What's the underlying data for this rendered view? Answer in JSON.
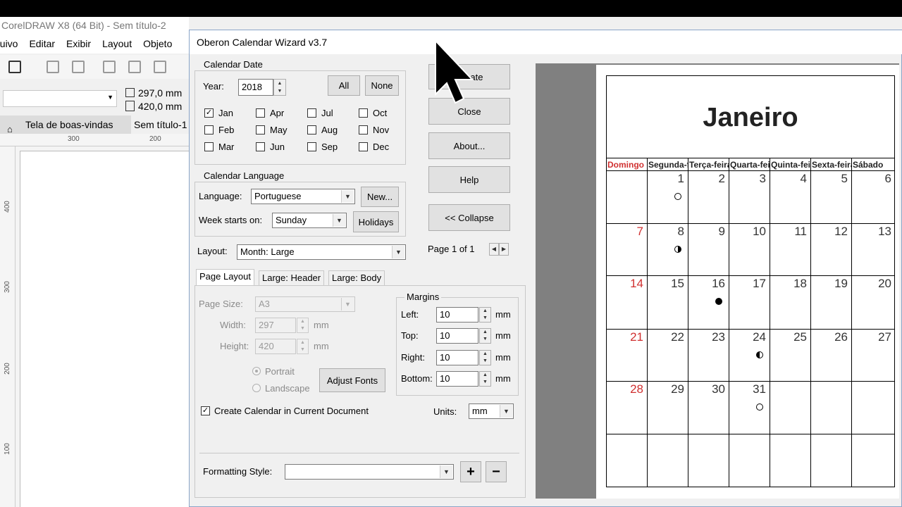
{
  "corel": {
    "title": "CorelDRAW X8 (64 Bit) - Sem título-2",
    "menu": [
      "Arquivo",
      "Editar",
      "Exibir",
      "Layout",
      "Objeto"
    ],
    "width_value": "297,0 mm",
    "height_value": "420,0 mm",
    "tabs": [
      "Tela de boas-vindas",
      "Sem título-1"
    ],
    "ruler_ticks": [
      "300",
      "200"
    ],
    "vruler_ticks": [
      "400",
      "300",
      "200",
      "100"
    ]
  },
  "dialog": {
    "title": "Oberon Calendar Wizard v3.7",
    "calendar_date": {
      "legend": "Calendar Date",
      "year_label": "Year:",
      "year_value": "2018",
      "all_label": "All",
      "none_label": "None",
      "months": [
        {
          "label": "Jan",
          "checked": true
        },
        {
          "label": "Feb",
          "checked": false
        },
        {
          "label": "Mar",
          "checked": false
        },
        {
          "label": "Apr",
          "checked": false
        },
        {
          "label": "May",
          "checked": false
        },
        {
          "label": "Jun",
          "checked": false
        },
        {
          "label": "Jul",
          "checked": false
        },
        {
          "label": "Aug",
          "checked": false
        },
        {
          "label": "Sep",
          "checked": false
        },
        {
          "label": "Oct",
          "checked": false
        },
        {
          "label": "Nov",
          "checked": false
        },
        {
          "label": "Dec",
          "checked": false
        }
      ]
    },
    "language": {
      "legend": "Calendar Language",
      "language_label": "Language:",
      "language_value": "Portuguese",
      "new_label": "New...",
      "week_label": "Week starts on:",
      "week_value": "Sunday",
      "holidays_label": "Holidays"
    },
    "layout_label": "Layout:",
    "layout_value": "Month: Large",
    "buttons": {
      "create": "Create",
      "close": "Close",
      "about": "About...",
      "help": "Help",
      "collapse": "<< Collapse"
    },
    "page_indicator": "Page 1 of 1",
    "tabs": [
      "Page Layout",
      "Large: Header",
      "Large: Body"
    ],
    "page_layout": {
      "page_size_label": "Page Size:",
      "page_size_value": "A3",
      "width_label": "Width:",
      "width_value": "297",
      "height_label": "Height:",
      "height_value": "420",
      "unit": "mm",
      "portrait_label": "Portrait",
      "landscape_label": "Landscape",
      "adjust_fonts_label": "Adjust Fonts",
      "create_in_doc_label": "Create Calendar in Current Document",
      "create_in_doc_checked": true
    },
    "margins": {
      "legend": "Margins",
      "left_label": "Left:",
      "left_value": "10",
      "top_label": "Top:",
      "top_value": "10",
      "right_label": "Right:",
      "right_value": "10",
      "bottom_label": "Bottom:",
      "bottom_value": "10",
      "unit": "mm"
    },
    "units_label": "Units:",
    "units_value": "mm",
    "formatting_label": "Formatting Style:",
    "formatting_value": "",
    "add_label": "+",
    "remove_label": "−"
  },
  "preview": {
    "month_title": "Janeiro",
    "weekdays": [
      "Domingo",
      "Segunda-feira",
      "Terça-feira",
      "Quarta-feira",
      "Quinta-feira",
      "Sexta-feira",
      "Sábado"
    ],
    "weeks": [
      [
        "",
        "1",
        "2",
        "3",
        "4",
        "5",
        "6"
      ],
      [
        "7",
        "8",
        "9",
        "10",
        "11",
        "12",
        "13"
      ],
      [
        "14",
        "15",
        "16",
        "17",
        "18",
        "19",
        "20"
      ],
      [
        "21",
        "22",
        "23",
        "24",
        "25",
        "26",
        "27"
      ],
      [
        "28",
        "29",
        "30",
        "31",
        "",
        "",
        ""
      ],
      [
        "",
        "",
        "",
        "",
        "",
        "",
        ""
      ]
    ],
    "sunday_color": "#d03030",
    "moons": [
      {
        "day": "1",
        "phase": "full"
      },
      {
        "day": "8",
        "phase": "last-quarter"
      },
      {
        "day": "16",
        "phase": "new"
      },
      {
        "day": "24",
        "phase": "first-quarter"
      },
      {
        "day": "31",
        "phase": "full"
      }
    ]
  }
}
